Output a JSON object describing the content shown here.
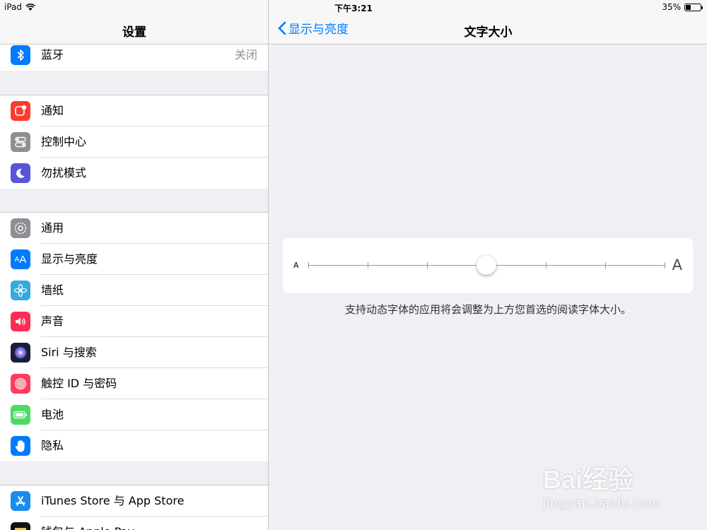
{
  "status_bar": {
    "device": "iPad",
    "time": "下午3:21",
    "battery_text": "35%",
    "battery_level": 0.35
  },
  "master": {
    "title": "设置",
    "items": [
      {
        "label": "蓝牙",
        "detail": "关闭",
        "icon": "bluetooth-icon",
        "color": "#007aff"
      },
      {
        "label": "通知",
        "icon": "notifications-icon",
        "color": "#ff3b30"
      },
      {
        "label": "控制中心",
        "icon": "control-center-icon",
        "color": "#8e8e93"
      },
      {
        "label": "勿扰模式",
        "icon": "moon-icon",
        "color": "#5856d6"
      },
      {
        "label": "通用",
        "icon": "gear-icon",
        "color": "#8e8e93"
      },
      {
        "label": "显示与亮度",
        "icon": "display-brightness-icon",
        "color": "#007aff"
      },
      {
        "label": "墙纸",
        "icon": "wallpaper-icon",
        "color": "#35aadc"
      },
      {
        "label": "声音",
        "icon": "speaker-icon",
        "color": "#ff2d55"
      },
      {
        "label": "Siri 与搜索",
        "icon": "siri-icon",
        "color": "#1c1c3a"
      },
      {
        "label": "触控 ID 与密码",
        "icon": "fingerprint-icon",
        "color": "#ff3b5c"
      },
      {
        "label": "电池",
        "icon": "battery-icon",
        "color": "#4cd964"
      },
      {
        "label": "隐私",
        "icon": "hand-icon",
        "color": "#007aff"
      },
      {
        "label": "iTunes Store 与 App Store",
        "icon": "app-store-icon",
        "color": "#1a8cf0"
      },
      {
        "label": "钱包与 Apple Pay",
        "icon": "wallet-icon",
        "color": "#111111"
      }
    ]
  },
  "detail": {
    "back_label": "显示与亮度",
    "title": "文字大小",
    "slider": {
      "min_label": "A",
      "max_label": "A",
      "steps": 7,
      "value_index": 3
    },
    "footnote": "支持动态字体的应用将会调整为上方您首选的阅读字体大小。"
  },
  "watermark": {
    "main": "Bai经验",
    "sub": "jingyan.baidu.com"
  }
}
